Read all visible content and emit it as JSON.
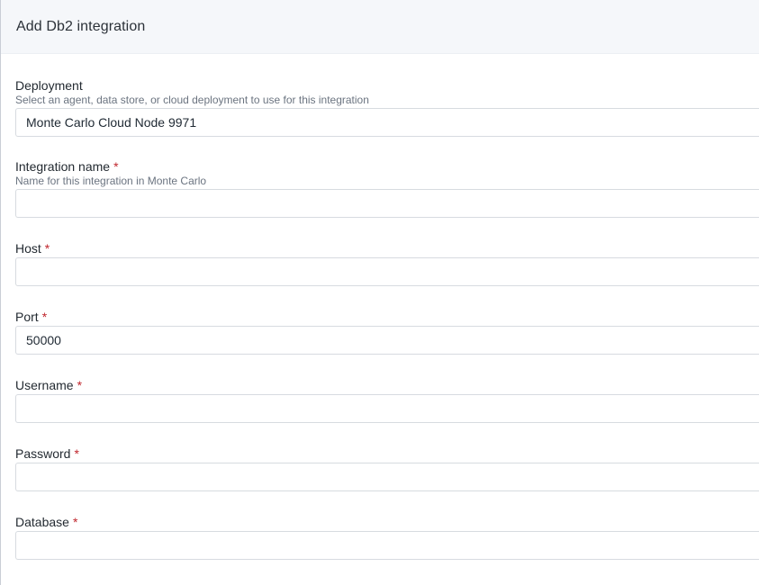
{
  "header": {
    "title": "Add Db2 integration"
  },
  "form": {
    "deployment": {
      "label": "Deployment",
      "hint": "Select an agent, data store, or cloud deployment to use for this integration",
      "value": "Monte Carlo Cloud Node 9971"
    },
    "integration_name": {
      "label": "Integration name",
      "required_mark": "*",
      "hint": "Name for this integration in Monte Carlo",
      "value": ""
    },
    "host": {
      "label": "Host",
      "required_mark": "*",
      "value": ""
    },
    "port": {
      "label": "Port",
      "required_mark": "*",
      "value": "50000"
    },
    "username": {
      "label": "Username",
      "required_mark": "*",
      "value": ""
    },
    "password": {
      "label": "Password",
      "required_mark": "*",
      "value": ""
    },
    "database": {
      "label": "Database",
      "required_mark": "*",
      "value": ""
    }
  },
  "colors": {
    "header_bg": "#f5f7fa",
    "required": "#c0262d",
    "border": "#d7dbe0",
    "hint_text": "#6b7480"
  }
}
